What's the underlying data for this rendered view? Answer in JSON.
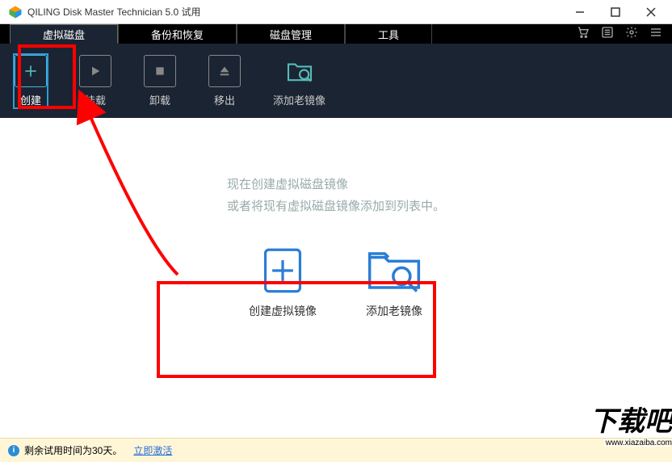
{
  "window": {
    "title": "QILING Disk Master Technician 5.0 试用"
  },
  "tabs": [
    {
      "label": "虚拟磁盘",
      "active": true
    },
    {
      "label": "备份和恢复",
      "active": false
    },
    {
      "label": "磁盘管理",
      "active": false
    },
    {
      "label": "工具",
      "active": false
    }
  ],
  "toolbar": [
    {
      "label": "创建",
      "icon": "plus",
      "active": true
    },
    {
      "label": "挂载",
      "icon": "play",
      "active": false
    },
    {
      "label": "卸载",
      "icon": "stop",
      "active": false
    },
    {
      "label": "移出",
      "icon": "eject",
      "active": false
    },
    {
      "label": "添加老镜像",
      "icon": "folder",
      "active": false
    }
  ],
  "hint": {
    "line1": "现在创建虚拟磁盘镜像",
    "line2": "或者将现有虚拟磁盘镜像添加到列表中。"
  },
  "actions": [
    {
      "label": "创建虚拟镜像",
      "icon": "plus-doc"
    },
    {
      "label": "添加老镜像",
      "icon": "folder-search"
    }
  ],
  "status": {
    "text": "剩余试用时间为30天。",
    "link": "立即激活"
  },
  "watermark": {
    "text": "下载吧",
    "url": "www.xiazaiba.com"
  }
}
